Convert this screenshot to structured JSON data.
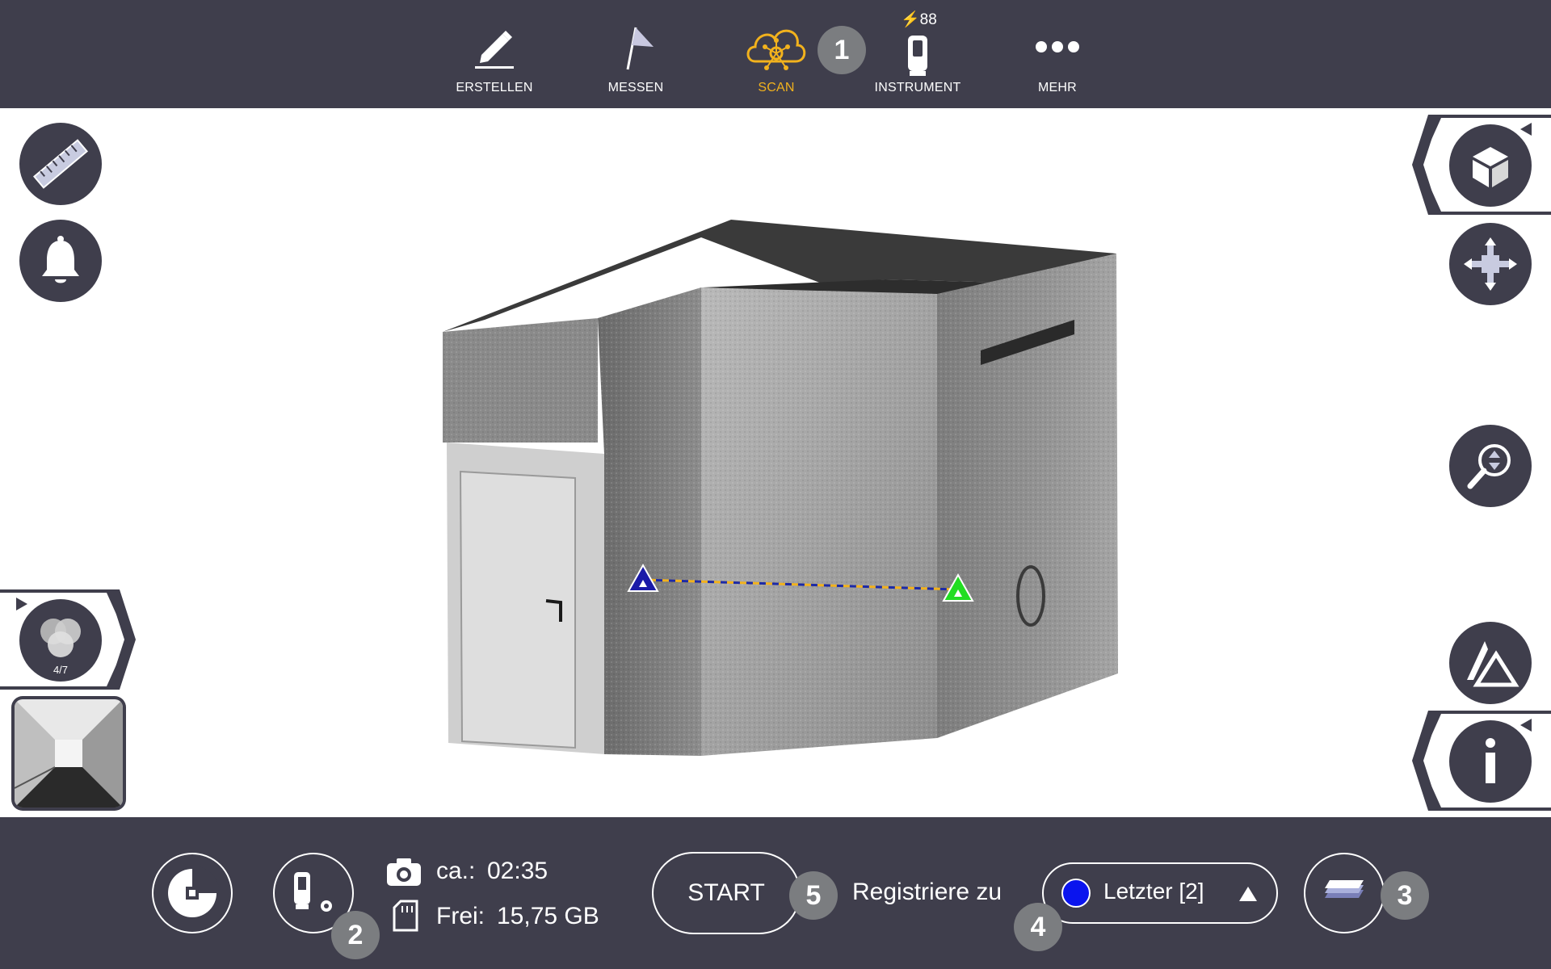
{
  "topbar": {
    "items": [
      {
        "label": "ERSTELLEN",
        "icon": "pencil-icon"
      },
      {
        "label": "MESSEN",
        "icon": "flag-icon"
      },
      {
        "label": "SCAN",
        "icon": "cloud-scan-icon",
        "active": true
      },
      {
        "label": "INSTRUMENT",
        "icon": "instrument-icon",
        "battery": "88"
      },
      {
        "label": "MEHR",
        "icon": "more-dots-icon"
      }
    ],
    "active_color": "#f2b21d"
  },
  "callouts": [
    "1",
    "2",
    "3",
    "4",
    "5"
  ],
  "left_toolbar": {
    "buttons": [
      "ruler-icon",
      "bell-icon"
    ],
    "scan_filter": {
      "icon": "venn-filter-icon",
      "count": "4/7"
    }
  },
  "right_toolbar": {
    "buttons": [
      "cube-view-icon",
      "move-icon",
      "zoom-icon",
      "triangle-target-icon",
      "info-icon"
    ]
  },
  "viewport": {
    "markers": [
      {
        "name": "blue-target",
        "color": "#1a1aa8"
      },
      {
        "name": "green-target",
        "color": "#22dd22"
      }
    ],
    "line_colors": [
      "#1c2aa8",
      "#f2b21d"
    ]
  },
  "bottombar": {
    "scan_time_label": "ca.:",
    "scan_time_value": "02:35",
    "free_label": "Frei:",
    "free_value": "15,75 GB",
    "start_label": "START",
    "register_label": "Registriere zu",
    "register_target": "Letzter [2]",
    "register_dot_color": "#0a14ee"
  }
}
